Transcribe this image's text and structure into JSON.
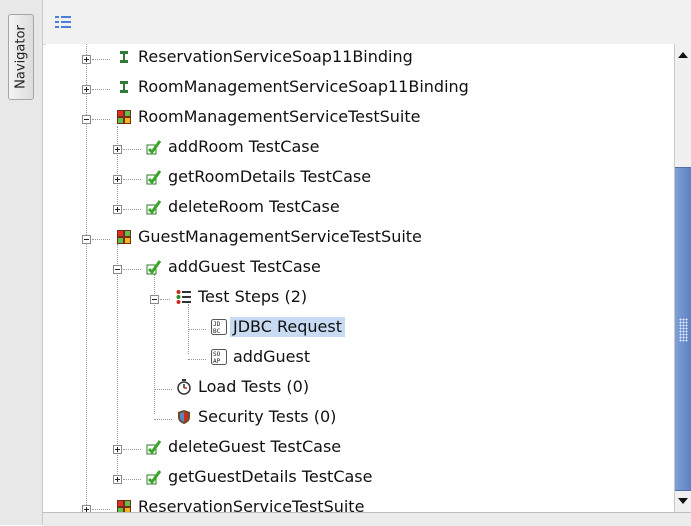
{
  "navigator_tab": {
    "label": "Navigator"
  },
  "toolbar": {
    "icon": "tree-view-icon"
  },
  "tree": {
    "items": [
      {
        "label": "ReservationServiceSoap11Binding",
        "icon": "interface-icon",
        "expanded": false
      },
      {
        "label": "RoomManagementServiceSoap11Binding",
        "icon": "interface-icon",
        "expanded": false
      },
      {
        "label": "RoomManagementServiceTestSuite",
        "icon": "testsuite-icon",
        "expanded": true
      },
      {
        "label": "addRoom TestCase",
        "icon": "testcase-icon",
        "expanded": false
      },
      {
        "label": "getRoomDetails TestCase",
        "icon": "testcase-icon",
        "expanded": false
      },
      {
        "label": "deleteRoom TestCase",
        "icon": "testcase-icon",
        "expanded": false
      },
      {
        "label": "GuestManagementServiceTestSuite",
        "icon": "testsuite-icon",
        "expanded": true
      },
      {
        "label": "addGuest TestCase",
        "icon": "testcase-icon",
        "expanded": true
      },
      {
        "label": "Test Steps (2)",
        "icon": "test-steps-icon",
        "expanded": true
      },
      {
        "label": "JDBC Request",
        "icon": "jdbc-request-icon",
        "selected": true
      },
      {
        "label": "addGuest",
        "icon": "soap-request-icon"
      },
      {
        "label": "Load Tests (0)",
        "icon": "load-tests-icon"
      },
      {
        "label": "Security Tests (0)",
        "icon": "security-tests-icon"
      },
      {
        "label": "deleteGuest TestCase",
        "icon": "testcase-icon",
        "expanded": false
      },
      {
        "label": "getGuestDetails TestCase",
        "icon": "testcase-icon",
        "expanded": false
      },
      {
        "label": "ReservationServiceTestSuite",
        "icon": "testsuite-icon",
        "expanded": false
      }
    ]
  },
  "colors": {
    "selection": "#c8dbf3",
    "scroll_thumb": "#6a8ccb"
  }
}
